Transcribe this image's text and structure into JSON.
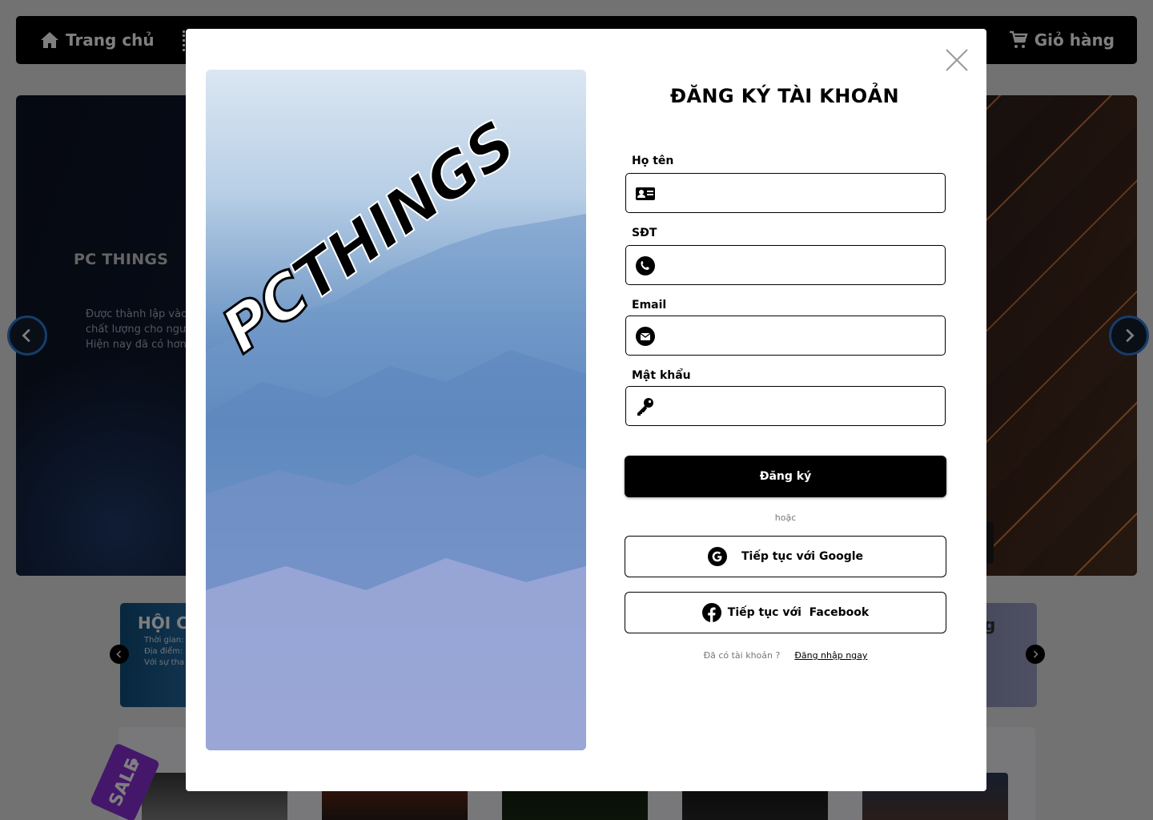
{
  "navbar": {
    "home_label": "Trang chủ",
    "cart_label": "Giỏ hàng"
  },
  "hero": {
    "title": "PC THINGS",
    "description_lines": [
      "Được thành lập vào",
      "chất lượng cho ngư",
      "Hiện nay đã có hơn"
    ]
  },
  "event": {
    "title": "HỘI C",
    "meta_lines": [
      "Thời gian:",
      "Địa điểm:",
      "Với sự tha"
    ],
    "tail_text": "g"
  },
  "sale": {
    "tag_label": "SALE"
  },
  "modal": {
    "logo": {
      "pc": "PC",
      "things": "THINGS"
    },
    "title": "ĐĂNG KÝ TÀI KHOẢN",
    "fields": {
      "fullname": {
        "label": "Họ tên",
        "value": "",
        "icon": "id-card-icon"
      },
      "phone": {
        "label": "SĐT",
        "value": "",
        "icon": "phone-icon"
      },
      "email": {
        "label": "Email",
        "value": "",
        "icon": "envelope-icon"
      },
      "password": {
        "label": "Mật khẩu",
        "value": "",
        "icon": "key-icon"
      }
    },
    "submit_label": "Đăng ký",
    "or_text": "hoặc",
    "google_label": "Tiếp tục với Google",
    "facebook_label": "Tiếp tục với  Facebook",
    "have_account_text": "Đã có tài khoản ?",
    "login_link_label": "Đăng nhập ngay"
  },
  "colors": {
    "primary": "#000000",
    "overlay": "rgba(0,0,0,0.5)",
    "carousel_arrow_border": "#2a7bd8",
    "sale_tag": "#8a2fd6",
    "facebook_blue": "#000000"
  }
}
